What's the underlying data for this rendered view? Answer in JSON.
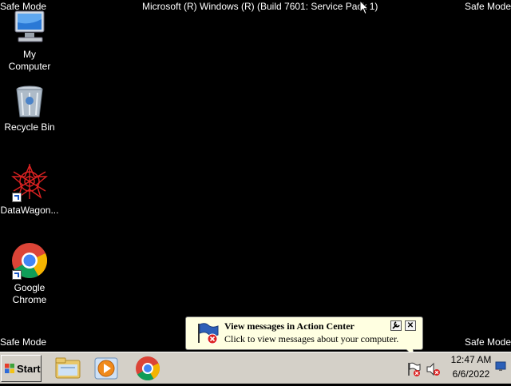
{
  "safe_mode": {
    "top_left": "Safe Mode",
    "top_right": "Safe Mode",
    "bottom_left": "Safe Mode",
    "bottom_right": "Safe Mode"
  },
  "os_build_text": "Microsoft (R) Windows (R) (Build 7601: Service Pack 1)",
  "desktop_icons": [
    {
      "label": "My\nComputer",
      "icon": "computer-icon"
    },
    {
      "label": "Recycle Bin",
      "icon": "recycle-bin-icon"
    },
    {
      "label": "DataWagon...",
      "icon": "datawagon-icon"
    },
    {
      "label": "Google\nChrome",
      "icon": "chrome-icon"
    }
  ],
  "balloon": {
    "title": "View messages in Action Center",
    "text": "Click to view messages about your computer.",
    "close_glyph": "✕",
    "wrench_glyph": "🔧"
  },
  "taskbar": {
    "start_label": "Start",
    "pinned": [
      "folder-icon",
      "media-player-icon",
      "chrome-icon"
    ],
    "clock_time": "12:47 AM",
    "clock_date": "6/6/2022"
  }
}
